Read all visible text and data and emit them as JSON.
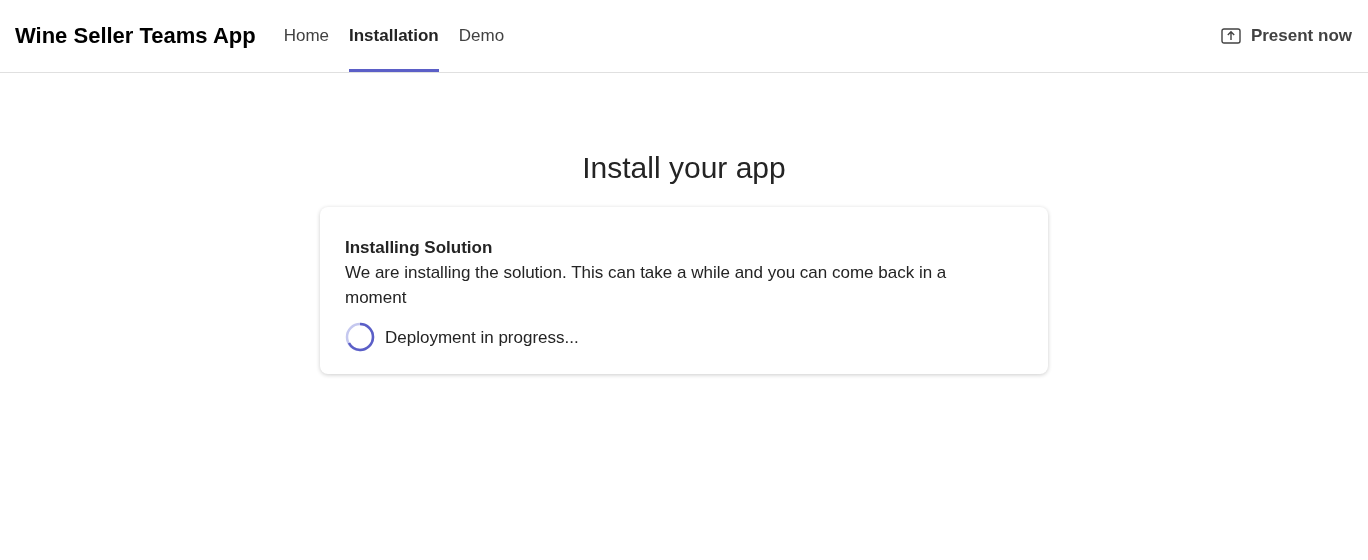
{
  "app": {
    "title": "Wine Seller Teams App"
  },
  "tabs": [
    {
      "label": "Home",
      "selected": false
    },
    {
      "label": "Installation",
      "selected": true
    },
    {
      "label": "Demo",
      "selected": false
    }
  ],
  "present_button": {
    "label": "Present now"
  },
  "heading": "Install your app",
  "card": {
    "title": "Installing Solution",
    "message": "We are installing the solution. This can take a while and you can come back in a moment",
    "status": "Deployment in progress..."
  }
}
